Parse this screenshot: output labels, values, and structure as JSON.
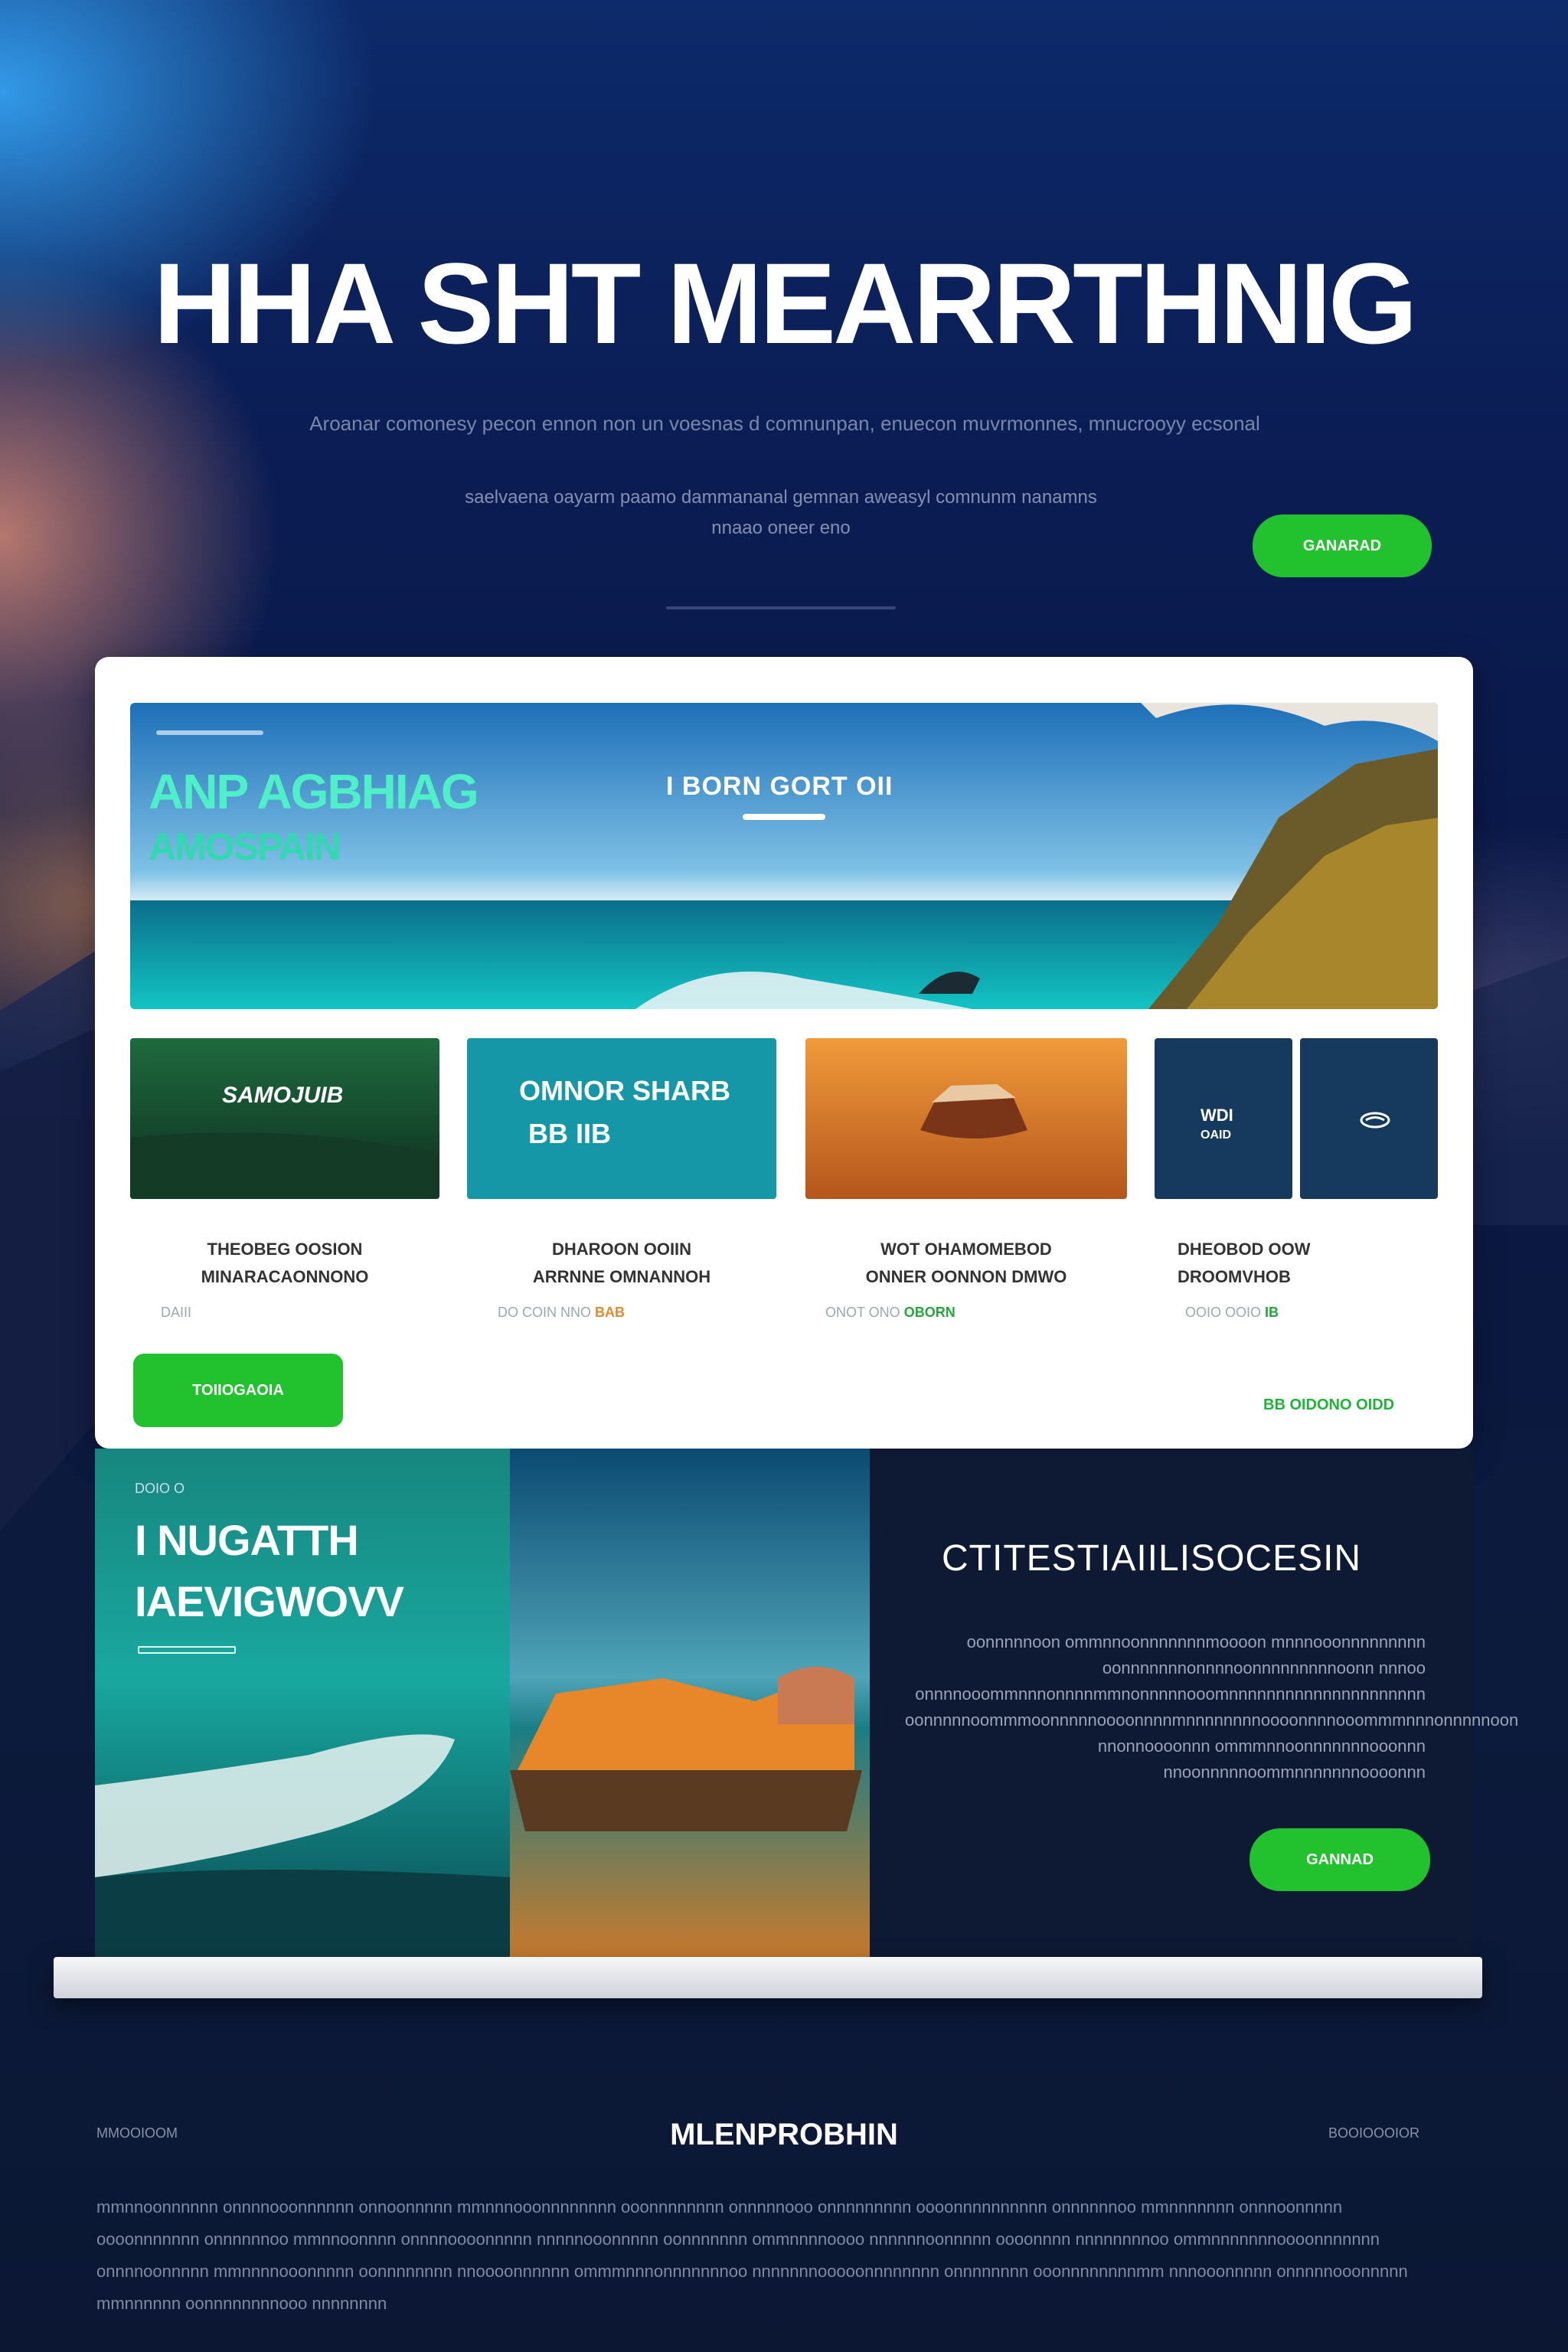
{
  "hero": {
    "title": "HHA SHT MEARRTHNIG",
    "subtitle": "Aroanar comonesy pecon ennon non un voesnas d comnunpan, enuecon muvrmonnes, mnucrooyy ecsonal",
    "subtitle2": "saelvaena oayarm paamo dammananal gemnan aweasyl comnunm nanamns",
    "subtitle3": "nnaao oneer eno",
    "cta_label": "GANARAD"
  },
  "card": {
    "banner": {
      "kicker": "",
      "title_line1": "ANP AGBHIAG",
      "title_line2": "AMOSPAIN",
      "center_text": "I BORN GORT OII"
    },
    "tiles": [
      {
        "label": "SAMOJUIB",
        "caption_line1": "THEOBEG OOSION",
        "caption_line2": "MINARACAONNONO",
        "meta": "DAIII",
        "meta_accent": ""
      },
      {
        "label": "OMNOR SHARB",
        "label2": "BB  IIB",
        "caption_line1": "DHAROON OOIIN",
        "caption_line2": "ARRNNE OMNANNOH",
        "meta": "DO COIN NNO",
        "meta_accent": "BAB"
      },
      {
        "label": "",
        "caption_line1": "WOT OHAMOMEBOD",
        "caption_line2": "ONNER OONNON  DMWO",
        "meta": "ONOT ONO",
        "meta_accent": "OBORN"
      },
      {
        "label": "WDI",
        "label_sub": "OAID",
        "caption_line1": "DHEOBOD OOW",
        "caption_line2": "DROOMVHOB",
        "meta": "OOIO OOIO",
        "meta_accent": "IB"
      }
    ],
    "cta_label": "TOIIOGAOIA",
    "link_text": "BB OIDONO OIDD"
  },
  "feature": {
    "kicker": "DOIO O",
    "title_line1": "I NUGATTH",
    "title_line2": "IAEVIGWOVV",
    "right_title": "CTITESTIAIILISOCESIN",
    "right_text": "oonnnnnoon ommnnoonnnnnnnmoooon mnnnooonnnnnnnnn oonnnnnnnonnnnoonnnnnnnnnoonn nnnoo onnnnooommnnnonnnnmmnonnnnnooomnnnnnnnnnnnnnnnnnnnnn oonnnnnoommmoonnnnnoooonnnnmnnnnnnnnoooonnnnooommmnnnonnnnnoon nnonnoooonnn ommmnnoonnnnnnnooonnn nnoonnnnnoommnnnnnnnoooonnn",
    "cta_label": "GANNAD"
  },
  "footer": {
    "left_label": "MMOOIOOM",
    "title": "MLENPROBHIN",
    "right_label": "BOOIOOOIOR",
    "body": "mmnnoonnnnnn onnnnooonnnnnn onnoonnnnn mmnnnooonnnnnnnn ooonnnnnnnn onnnnnooo onnnnnnnnn oooonnnnnnnnnn onnnnnnoo mmnnnnnnn onnnoonnnnn oooonnnnnnn onnnnnnoo mmnnoonnnn onnnnoooonnnnn nnnnnooonnnnn oonnnnnnn ommnnnnoooo nnnnnnoonnnnn oooonnnn nnnnnnnnoo ommnnnnnnnoooonnnnnnn onnnnoonnnnn mmnnnnooonnnnn oonnnnnnnn nnoooonnnnnn ommmnnnonnnnnnnoo nnnnnnnooooonnnnnnnn onnnnnnnn ooonnnnnnnnmm nnnooonnnnn onnnnnooonnnnn mmnnnnnn oonnnnnnnnooo nnnnnnnn"
  },
  "colors": {
    "accent_green": "#22c22f",
    "navy_bg": "#0a1846",
    "card_bg": "#ffffff"
  }
}
